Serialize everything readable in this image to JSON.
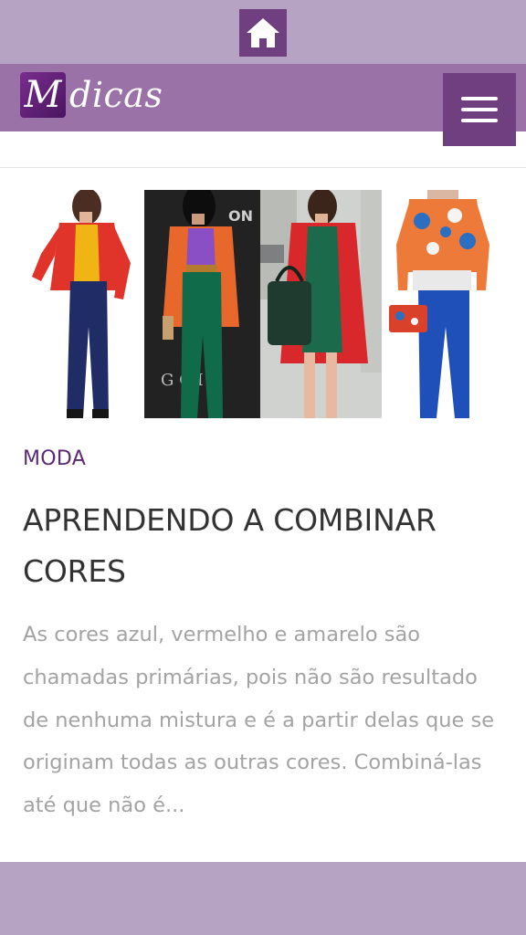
{
  "nav": {
    "home_icon": "home-icon",
    "menu_icon": "hamburger-menu-icon"
  },
  "header": {
    "logo_letter": "M",
    "logo_text": "dicas"
  },
  "post": {
    "category": "MODA",
    "title": "APRENDENDO A COMBINAR CORES",
    "excerpt": "As cores azul, vermelho e amarelo são chamadas primárias, pois não são resultado de nenhuma mistura e é a partir delas que se originam todas as outras cores. Combiná-las até que não é..."
  },
  "colors": {
    "topbar": "#b6a3c4",
    "header": "#9a72a8",
    "accent": "#6f3f80",
    "category": "#5b2a73"
  }
}
